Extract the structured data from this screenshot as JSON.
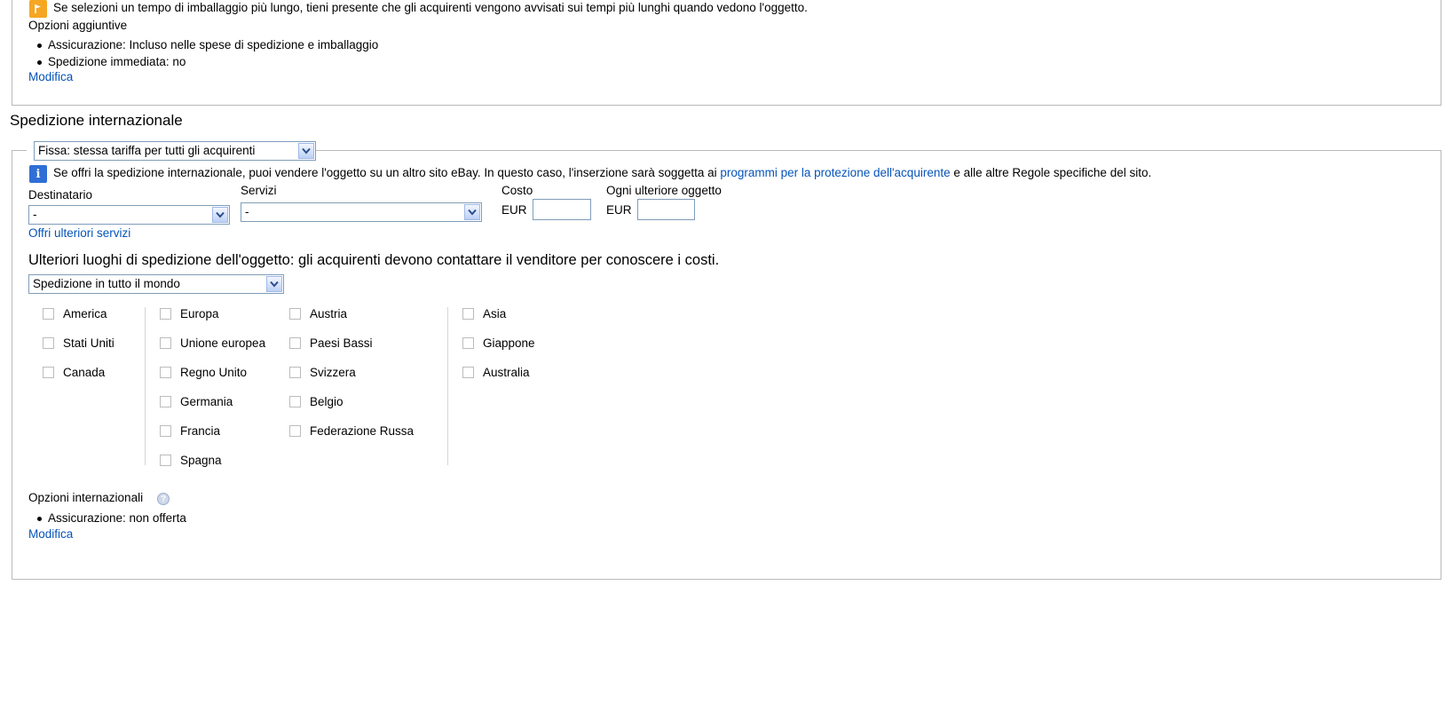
{
  "domestic": {
    "packaging_notice": "Se selezioni un tempo di imballaggio più lungo, tieni presente che gli acquirenti vengono avvisati sui tempi più lunghi quando vedono l'oggetto.",
    "options_title": "Opzioni aggiuntive",
    "options": [
      "Assicurazione: Incluso nelle spese di spedizione e imballaggio",
      "Spedizione immediata: no"
    ],
    "edit_link": "Modifica"
  },
  "international": {
    "section_title": "Spedizione internazionale",
    "rate_type_selected": "Fissa: stessa tariffa per tutti gli acquirenti",
    "info_text_before": "Se offri la spedizione internazionale, puoi vendere l'oggetto su un altro sito eBay. In questo caso, l'inserzione sarà soggetta ai ",
    "info_link": "programmi per la protezione dell'acquirente",
    "info_text_after": " e alle altre Regole specifiche del sito.",
    "labels": {
      "destination": "Destinatario",
      "services": "Servizi",
      "cost": "Costo",
      "additional_item": "Ogni ulteriore oggetto"
    },
    "destination_selected": "-",
    "service_selected": "-",
    "currency": "EUR",
    "cost_value": "",
    "additional_value": "",
    "more_services_link": "Offri ulteriori servizi",
    "additional_locations_title": "Ulteriori luoghi di spedizione dell'oggetto: gli acquirenti devono contattare il venditore per conoscere i costi.",
    "locations_selected": "Spedizione in tutto il mondo",
    "regions": {
      "americas": [
        "America",
        "Stati Uniti",
        "Canada"
      ],
      "europe_col1": [
        "Europa",
        "Unione europea",
        "Regno Unito",
        "Germania",
        "Francia",
        "Spagna"
      ],
      "europe_col2": [
        "Austria",
        "Paesi Bassi",
        "Svizzera",
        "Belgio",
        "Federazione Russa"
      ],
      "asia": [
        "Asia",
        "Giappone",
        "Australia"
      ]
    },
    "intl_options_title": "Opzioni internazionali",
    "intl_options": [
      "Assicurazione: non offerta"
    ],
    "edit_link": "Modifica"
  },
  "icons": {
    "warning": "flag-icon",
    "info": "info-icon",
    "help": "help-icon",
    "dropdown": "chevron-down-icon"
  },
  "colors": {
    "link": "#0654ba",
    "warning": "#f5a623",
    "info": "#2f6fd6",
    "border": "#b9b9b9"
  }
}
